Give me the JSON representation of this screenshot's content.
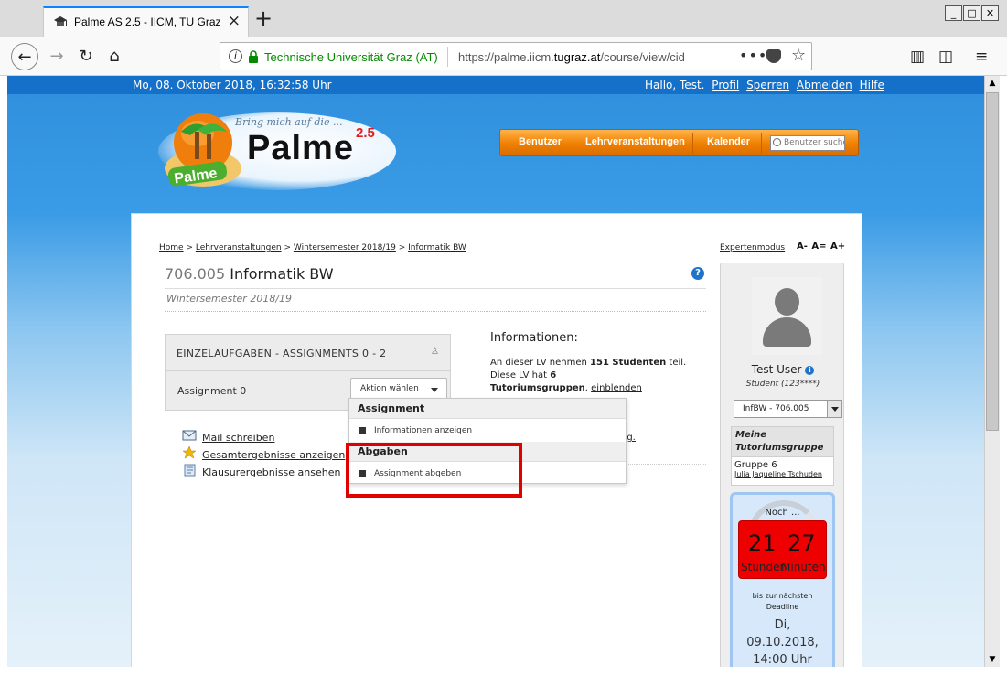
{
  "browser": {
    "tab_title": "Palme AS 2.5 - IICM, TU Graz",
    "url_org": "Technische Universität Graz (AT)",
    "url_prefix": "https://palme.iicm.",
    "url_domain": "tugraz.at",
    "url_suffix": "/course/view/cid",
    "url_more": "•••",
    "window_minimize": "_",
    "window_maximize": "□",
    "window_close": "✕"
  },
  "topbar": {
    "date": "Mo, 08. Oktober 2018, 16:32:58 Uhr",
    "greeting": "Hallo, Test.",
    "links": [
      "Profil",
      "Sperren",
      "Abmelden",
      "Hilfe"
    ]
  },
  "logo": {
    "tagline": "Bring mich auf die ...",
    "brand": "Palme",
    "version": "2.5",
    "badge": "Palme"
  },
  "menu": {
    "items": [
      "Benutzer",
      "Lehrveranstaltungen",
      "Kalender"
    ],
    "search_placeholder": "Benutzer suchen"
  },
  "breadcrumb": {
    "items": [
      "Home",
      "Lehrveranstaltungen",
      "Wintersemester 2018/19",
      "Informatik BW"
    ],
    "separator": ">"
  },
  "tools": {
    "expert_mode": "Expertenmodus",
    "font_small": "A-",
    "font_normal": "A=",
    "font_large": "A+"
  },
  "course": {
    "code": "706.005",
    "name": "Informatik BW",
    "semester": "Wintersemester 2018/19",
    "help": "?"
  },
  "assignments": {
    "header": "EINZELAUFGABEN - ASSIGNMENTS 0 - 2",
    "item_name": "Assignment 0",
    "action_label": "Aktion wählen"
  },
  "dropdown": {
    "section1": "Assignment",
    "item1": "Informationen anzeigen",
    "section2": "Abgaben",
    "item2": "Assignment abgeben"
  },
  "links": [
    {
      "label": "Mail schreiben",
      "icon": "mail-icon"
    },
    {
      "label": "Gesamtergebnisse anzeigen",
      "icon": "star-icon"
    },
    {
      "label": "Klausurergebnisse ansehen",
      "icon": "document-icon"
    }
  ],
  "info": {
    "title": "Informationen:",
    "text1": "An dieser LV nehmen ",
    "students": "151 Studenten",
    "text2": " teil. Diese LV hat ",
    "groups_count": "6",
    "groups_label": "Tutoriumsgruppen",
    "text3": ". ",
    "show_link": "einblenden",
    "tail_link": "ng."
  },
  "sidebar": {
    "user_name": "Test User",
    "info_icon": "i",
    "user_role": "Student (123****)",
    "course_select": "InfBW - 706.005",
    "tutorium_heading": "Meine Tutoriumsgruppe",
    "group_name": "Gruppe 6",
    "tutor_link": "Julia Jaqueline Tschuden"
  },
  "countdown": {
    "prefix": "Noch ...",
    "hours": "21",
    "minutes": "27",
    "hours_label": "Stunden",
    "minutes_label": "Minuten",
    "subtitle_line1": "bis zur nächsten",
    "subtitle_line2": "Deadline",
    "date_line1": "Di,",
    "date_line2": "09.10.2018,",
    "date_line3": "14:00 Uhr"
  },
  "colors": {
    "top_strip": "#1470c8",
    "menu_orange": "#ef7f00",
    "highlight_red": "#e00000",
    "countdown_red": "#ee0000",
    "link_blue": "#1f73c9"
  }
}
